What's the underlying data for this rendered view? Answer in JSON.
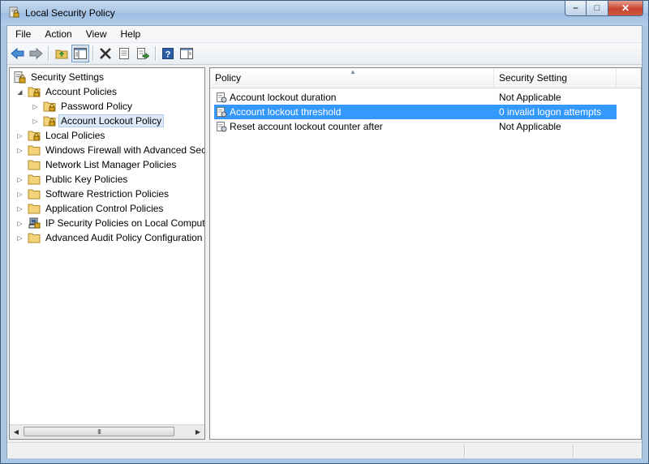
{
  "window": {
    "title": "Local Security Policy"
  },
  "caption": {
    "minimize": "–",
    "maximize": "□",
    "close": "✕"
  },
  "menu": [
    "File",
    "Action",
    "View",
    "Help"
  ],
  "toolbar": {
    "buttons": [
      "back-arrow-icon",
      "forward-arrow-icon",
      "up-folder-icon",
      "show-hide-tree-icon",
      "delete-icon",
      "properties-icon",
      "export-list-icon",
      "help-icon",
      "show-hide-action-pane-icon"
    ]
  },
  "tree": {
    "items": [
      {
        "label": "Security Settings"
      },
      {
        "label": "Account Policies"
      },
      {
        "label": "Password Policy"
      },
      {
        "label": "Account Lockout Policy"
      },
      {
        "label": "Local Policies"
      },
      {
        "label": "Windows Firewall with Advanced Secu"
      },
      {
        "label": "Network List Manager Policies"
      },
      {
        "label": "Public Key Policies"
      },
      {
        "label": "Software Restriction Policies"
      },
      {
        "label": "Application Control Policies"
      },
      {
        "label": "IP Security Policies on Local Compute"
      },
      {
        "label": "Advanced Audit Policy Configuration"
      }
    ],
    "scroll_grip": "III"
  },
  "list": {
    "columns": [
      "Policy",
      "Security Setting"
    ],
    "rows": [
      {
        "policy": "Account lockout duration",
        "setting": "Not Applicable"
      },
      {
        "policy": "Account lockout threshold",
        "setting": "0 invalid logon attempts"
      },
      {
        "policy": "Reset account lockout counter after",
        "setting": "Not Applicable"
      }
    ]
  },
  "colors": {
    "selection": "#3399ff",
    "tree_selection": "#dde9f7",
    "folder": "#f3d27a"
  }
}
